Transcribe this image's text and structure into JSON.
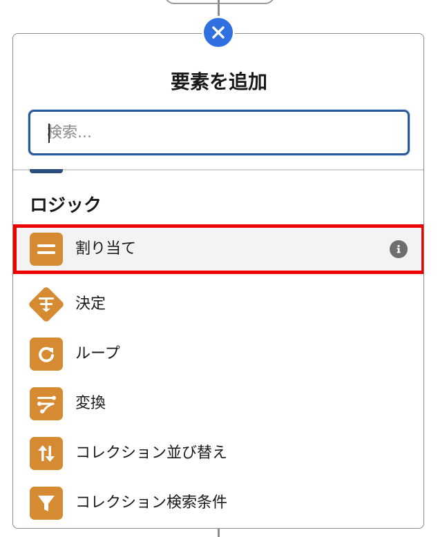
{
  "panel": {
    "title": "要素を追加",
    "close_icon": "close-icon"
  },
  "search": {
    "placeholder": "検索...",
    "value": ""
  },
  "section": {
    "heading": "ロジック"
  },
  "items": [
    {
      "label": "割り当て",
      "icon": "assignment-icon",
      "selected": true,
      "has_info": true
    },
    {
      "label": "決定",
      "icon": "decision-icon",
      "selected": false
    },
    {
      "label": "ループ",
      "icon": "loop-icon",
      "selected": false
    },
    {
      "label": "変換",
      "icon": "transform-icon",
      "selected": false
    },
    {
      "label": "コレクション並び替え",
      "icon": "collection-sort-icon",
      "selected": false
    },
    {
      "label": "コレクション検索条件",
      "icon": "collection-filter-icon",
      "selected": false
    }
  ],
  "colors": {
    "accent_blue": "#2f6fe0",
    "icon_orange": "#d68a31",
    "selection_red": "#ee0000",
    "search_border": "#2b5a9a"
  }
}
